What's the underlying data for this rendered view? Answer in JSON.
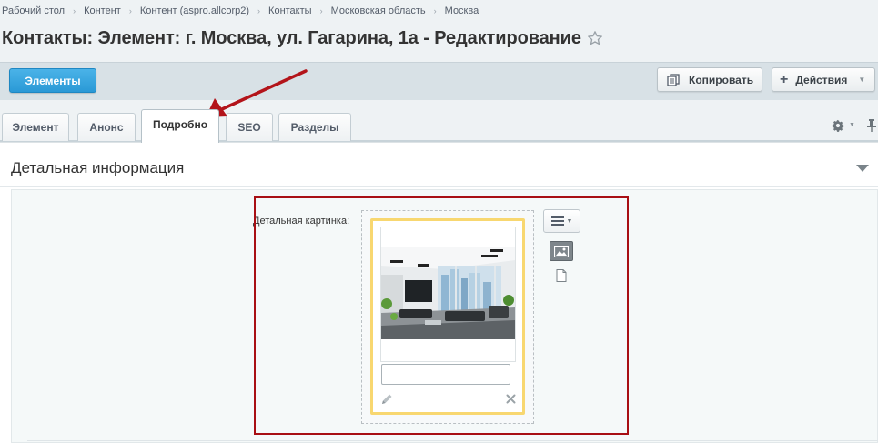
{
  "breadcrumb": {
    "items": [
      "Рабочий стол",
      "Контент",
      "Контент (aspro.allcorp2)",
      "Контакты",
      "Московская область",
      "Москва"
    ],
    "separator": "›"
  },
  "page": {
    "title": "Контакты: Элемент: г. Москва, ул. Гагарина, 1а - Редактирование",
    "favorite_icon": "star-icon"
  },
  "toolbar": {
    "elements_button": "Элементы",
    "copy_button": "Копировать",
    "actions_button": "Действия"
  },
  "tabs": [
    {
      "label": "Элемент",
      "active": false
    },
    {
      "label": "Анонс",
      "active": false
    },
    {
      "label": "Подробно",
      "active": true
    },
    {
      "label": "SEO",
      "active": false
    },
    {
      "label": "Разделы",
      "active": false
    }
  ],
  "section": {
    "title": "Детальная информация"
  },
  "detail_image": {
    "label": "Детальная картинка:",
    "caption_value": "",
    "photo_description_icon": "office-interior-photo"
  },
  "colors": {
    "accent": "#2a99d6",
    "highlight_border": "#a80f14",
    "card_border": "#f8d770",
    "toolbar_bg": "#d8e1e6"
  }
}
